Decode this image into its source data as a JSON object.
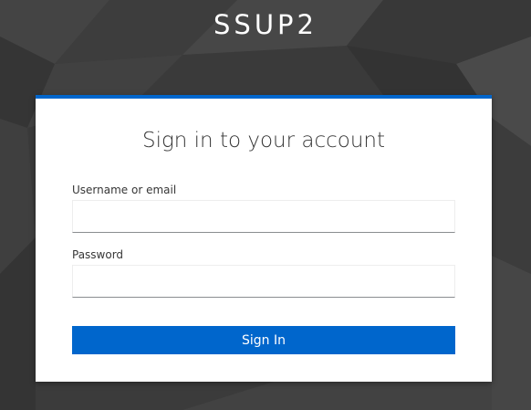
{
  "realm": {
    "name": "SSUP2"
  },
  "login": {
    "title": "Sign in to your account",
    "username_label": "Username or email",
    "username_value": "",
    "password_label": "Password",
    "password_value": "",
    "submit_label": "Sign In"
  },
  "colors": {
    "background": "#3a3a3a",
    "accent": "#0066cc",
    "card": "#ffffff"
  }
}
